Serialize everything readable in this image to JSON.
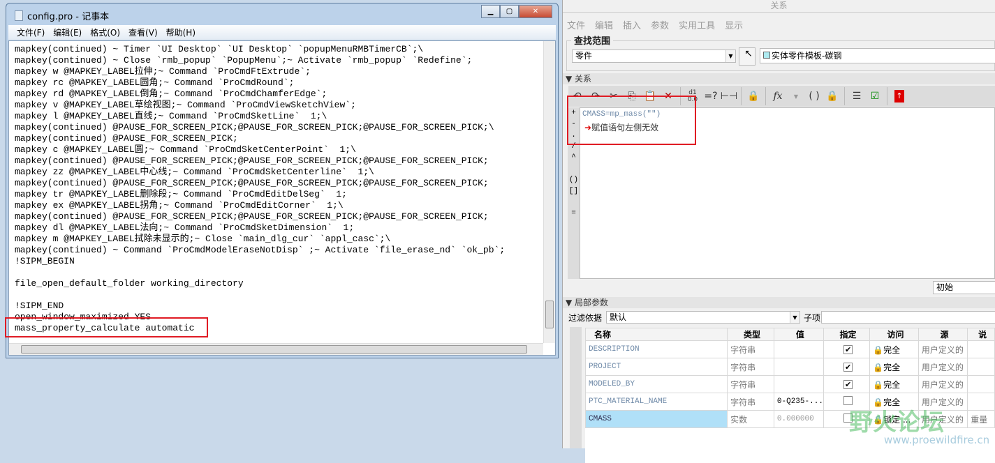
{
  "notepad": {
    "title": "config.pro - 记事本",
    "menu": [
      "文件(F)",
      "编辑(E)",
      "格式(O)",
      "查看(V)",
      "帮助(H)"
    ],
    "lines": [
      "mapkey(continued) ~ Timer `UI Desktop` `UI Desktop` `popupMenuRMBTimerCB`;\\",
      "mapkey(continued) ~ Close `rmb_popup` `PopupMenu`;~ Activate `rmb_popup` `Redefine`;",
      "mapkey w @MAPKEY_LABEL拉伸;~ Command `ProCmdFtExtrude`;",
      "mapkey rc @MAPKEY_LABEL圆角;~ Command `ProCmdRound`;",
      "mapkey rd @MAPKEY_LABEL倒角;~ Command `ProCmdChamferEdge`;",
      "mapkey v @MAPKEY_LABEL草绘视图;~ Command `ProCmdViewSketchView`;",
      "mapkey l @MAPKEY_LABEL直线;~ Command `ProCmdSketLine`  1;\\",
      "mapkey(continued) @PAUSE_FOR_SCREEN_PICK;@PAUSE_FOR_SCREEN_PICK;@PAUSE_FOR_SCREEN_PICK;\\",
      "mapkey(continued) @PAUSE_FOR_SCREEN_PICK;",
      "mapkey c @MAPKEY_LABEL圆;~ Command `ProCmdSketCenterPoint`  1;\\",
      "mapkey(continued) @PAUSE_FOR_SCREEN_PICK;@PAUSE_FOR_SCREEN_PICK;@PAUSE_FOR_SCREEN_PICK;",
      "mapkey zz @MAPKEY_LABEL中心线;~ Command `ProCmdSketCenterline`  1;\\",
      "mapkey(continued) @PAUSE_FOR_SCREEN_PICK;@PAUSE_FOR_SCREEN_PICK;@PAUSE_FOR_SCREEN_PICK;",
      "mapkey tr @MAPKEY_LABEL删除段;~ Command `ProCmdEditDelSeg`  1;",
      "mapkey ex @MAPKEY_LABEL拐角;~ Command `ProCmdEditCorner`  1;\\",
      "mapkey(continued) @PAUSE_FOR_SCREEN_PICK;@PAUSE_FOR_SCREEN_PICK;@PAUSE_FOR_SCREEN_PICK;",
      "mapkey dl @MAPKEY_LABEL法向;~ Command `ProCmdSketDimension`  1;",
      "mapkey m @MAPKEY_LABEL拭除未显示的;~ Close `main_dlg_cur` `appl_casc`;\\",
      "mapkey(continued) ~ Command `ProCmdModelEraseNotDisp` ;~ Activate `file_erase_nd` `ok_pb`;",
      "!SIPM_BEGIN",
      "",
      "file_open_default_folder working_directory",
      "",
      "!SIPM_END",
      "open_window_maximized YES",
      "mass_property_calculate automatic"
    ]
  },
  "relations": {
    "title": "关系",
    "menu": [
      "文件",
      "编辑",
      "插入",
      "参数",
      "实用工具",
      "显示"
    ],
    "scope_label": "查找范围",
    "scope_value": "零件",
    "model_name": "实体零件模板-碳钢",
    "section_label": "关系",
    "editor_line": "CMASS=mp_mass(\"\")",
    "error_text": "赋值语句左侧无效",
    "units_value": "初始",
    "toolbar_fx": "fx",
    "toolbar_eq": "=?"
  },
  "params": {
    "section_label": "局部参数",
    "filter_label": "过滤依据",
    "filter_value": "默认",
    "child_label": "子项",
    "columns": [
      "名称",
      "类型",
      "值",
      "指定",
      "访问",
      "源",
      "说"
    ],
    "rows": [
      {
        "name": "DESCRIPTION",
        "type": "字符串",
        "value": "",
        "designated": true,
        "access": "完全",
        "source": "用户定义的",
        "extra": ""
      },
      {
        "name": "PROJECT",
        "type": "字符串",
        "value": "",
        "designated": true,
        "access": "完全",
        "source": "用户定义的",
        "extra": ""
      },
      {
        "name": "MODELED_BY",
        "type": "字符串",
        "value": "",
        "designated": true,
        "access": "完全",
        "source": "用户定义的",
        "extra": ""
      },
      {
        "name": "PTC_MATERIAL_NAME",
        "type": "字符串",
        "value": "0-Q235-...",
        "designated": false,
        "access": "完全",
        "source": "用户定义的",
        "extra": ""
      },
      {
        "name": "CMASS",
        "type": "实数",
        "value": "0.000000",
        "designated": false,
        "access": "锁定 ...",
        "source": "用户定义的",
        "extra": "重量"
      }
    ]
  },
  "watermark": {
    "text": "野火论坛",
    "url": "www.proewildfire.cn"
  },
  "colors": {
    "highlight": "#e01b24",
    "selected_row": "#b0e0f8"
  }
}
